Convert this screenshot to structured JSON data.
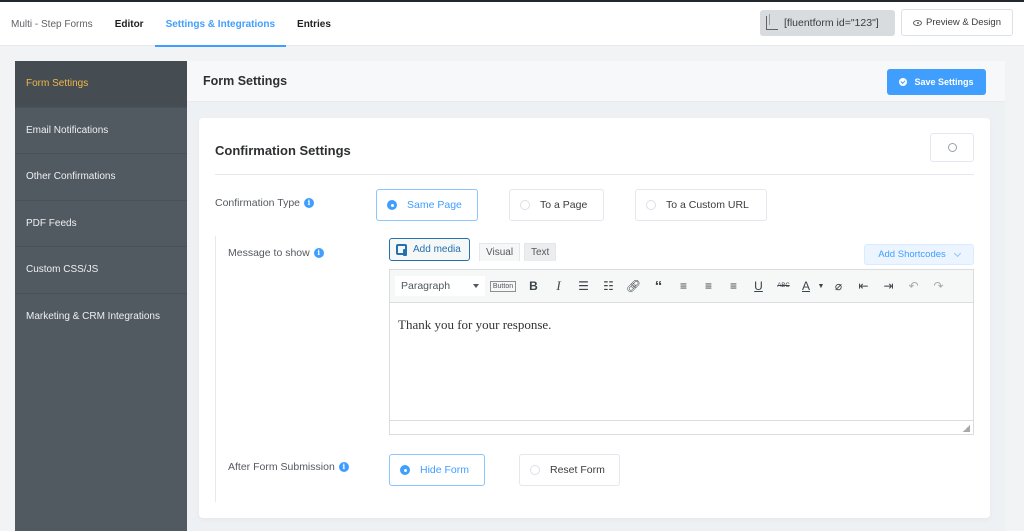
{
  "topbar": {
    "nav": [
      {
        "label": "Multi - Step Forms",
        "active": false
      },
      {
        "label": "Editor",
        "active": false
      },
      {
        "label": "Settings & Integrations",
        "active": true
      },
      {
        "label": "Entries",
        "active": false
      }
    ],
    "shortcode": "[fluentform id=\"123\"]",
    "preview_label": "Preview & Design"
  },
  "sidebar": {
    "items": [
      {
        "label": "Form Settings",
        "active": true
      },
      {
        "label": "Email Notifications",
        "active": false
      },
      {
        "label": "Other Confirmations",
        "active": false
      },
      {
        "label": "PDF Feeds",
        "active": false
      },
      {
        "label": "Custom CSS/JS",
        "active": false
      },
      {
        "label": "Marketing & CRM Integrations",
        "active": false
      }
    ]
  },
  "main": {
    "title": "Form Settings",
    "save_label": "Save Settings"
  },
  "card": {
    "title": "Confirmation Settings",
    "confirmation_type": {
      "label": "Confirmation Type",
      "options": [
        "Same Page",
        "To a Page",
        "To a Custom URL"
      ],
      "selected": "Same Page"
    },
    "message": {
      "label": "Message to show",
      "add_media": "Add media",
      "tab_visual": "Visual",
      "tab_text": "Text",
      "add_shortcodes": "Add Shortcodes",
      "format": "Paragraph",
      "button_label": "Button",
      "content": "Thank you for your response."
    },
    "after_submission": {
      "label": "After Form Submission",
      "options": [
        "Hide Form",
        "Reset Form"
      ],
      "selected": "Hide Form"
    }
  },
  "colors": {
    "accent": "#409eff",
    "sidebar_bg": "#525a61",
    "sidebar_active_text": "#f0b849"
  }
}
